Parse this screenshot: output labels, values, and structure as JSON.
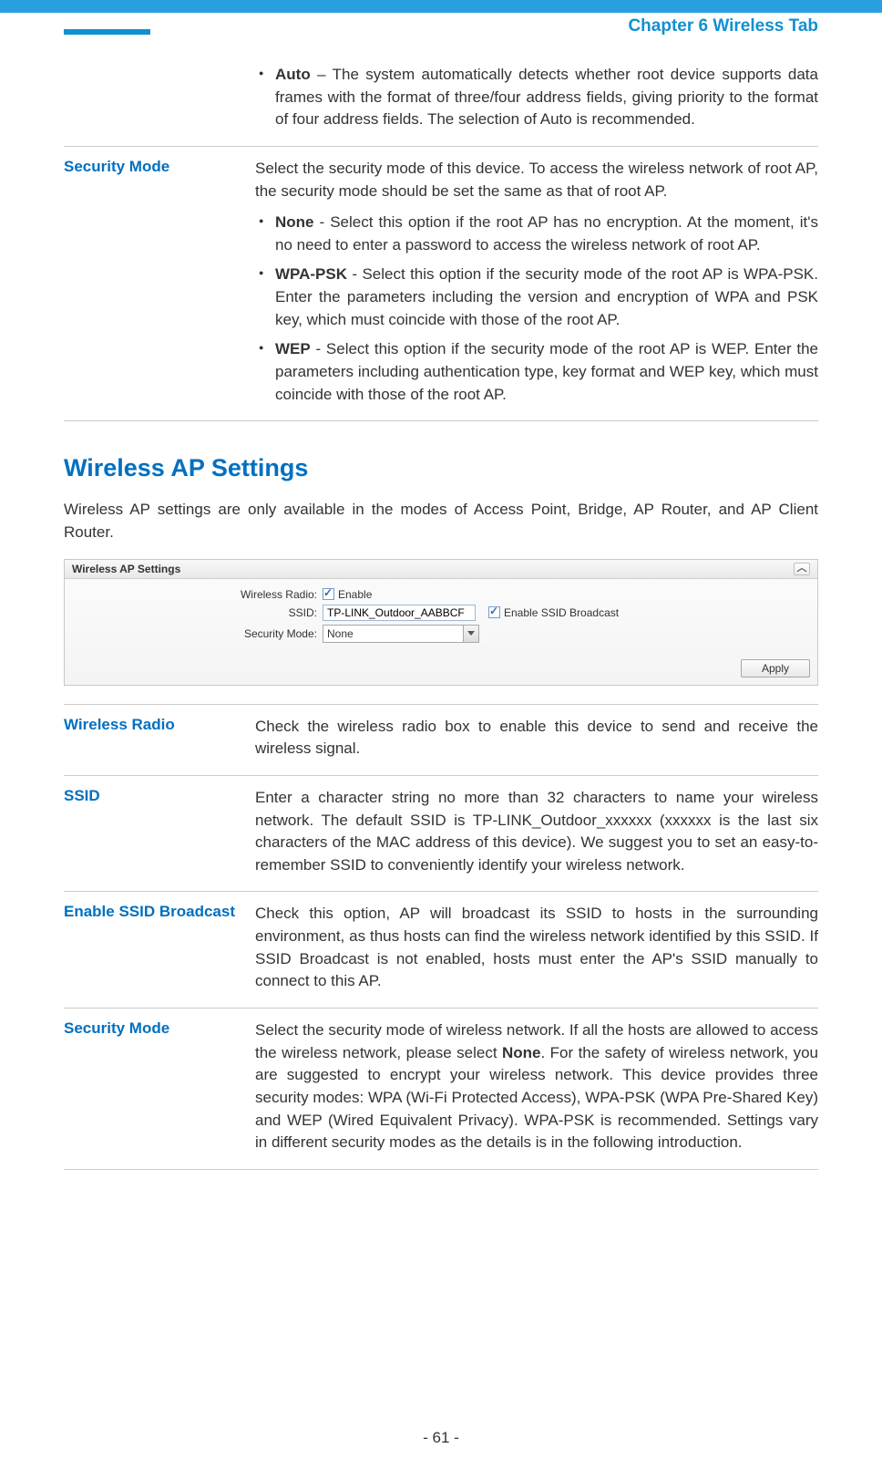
{
  "header": {
    "chapter_title": "Chapter 6 Wireless Tab"
  },
  "top_block": {
    "auto_bullet_bold": "Auto",
    "auto_bullet_text": " – The system automatically detects whether root device supports data frames with the format of three/four address fields, giving priority to the format of four address fields. The selection of Auto is recommended."
  },
  "security_mode_top": {
    "term": "Security Mode",
    "intro": "Select the security mode of this device. To access the wireless network of root AP, the security mode should be set the same as that of root AP.",
    "none_bold": "None",
    "none_text": " - Select this option if the root AP has no encryption. At the moment, it's no need to enter a password to access the wireless network of root AP.",
    "wpa_bold": "WPA-PSK",
    "wpa_text": " - Select this option if the security mode of the root AP is WPA-PSK. Enter the parameters including the version and encryption of WPA and PSK key, which must coincide with those of the root AP.",
    "wep_bold": "WEP",
    "wep_text": " - Select this option if the security mode of the root AP is WEP. Enter the parameters including authentication type, key format and WEP key, which must coincide with those of the root AP."
  },
  "section_title": "Wireless AP Settings",
  "section_intro": "Wireless AP settings are only available in the modes of Access Point, Bridge, AP Router, and AP Client Router.",
  "panel": {
    "title": "Wireless AP Settings",
    "collapse_glyph": "︿",
    "wireless_radio_label": "Wireless Radio:",
    "enable_label": "Enable",
    "ssid_label": "SSID:",
    "ssid_value": "TP-LINK_Outdoor_AABBCF",
    "enable_ssid_broadcast_label": "Enable SSID Broadcast",
    "security_mode_label": "Security Mode:",
    "security_mode_value": "None",
    "apply_label": "Apply"
  },
  "rows": {
    "wireless_radio": {
      "term": "Wireless Radio",
      "desc": "Check the wireless radio box to enable this device to send and receive the wireless signal."
    },
    "ssid": {
      "term": "SSID",
      "desc": "Enter a character string no more than 32 characters to name your wireless network. The default SSID is TP-LINK_Outdoor_xxxxxx (xxxxxx is the last six characters of the MAC address of this device). We suggest you to set an easy-to-remember SSID to conveniently identify your wireless network."
    },
    "enable_ssid_broadcast": {
      "term": "Enable SSID Broadcast",
      "desc": "Check this option, AP will broadcast its SSID to hosts in the surrounding environment, as thus hosts can find the wireless network identified by this SSID. If SSID Broadcast is not enabled, hosts must enter the AP's SSID manually to connect to this AP."
    },
    "security_mode": {
      "term": "Security Mode",
      "desc_pre": "Select the security mode of wireless network. If all the hosts are allowed to access the wireless network, please select ",
      "desc_bold": "None",
      "desc_post": ". For the safety of wireless network, you are suggested to encrypt your wireless network. This device provides three security modes: WPA (Wi-Fi Protected Access), WPA-PSK (WPA Pre-Shared Key) and WEP (Wired Equivalent Privacy). WPA-PSK is recommended. Settings vary in different security modes as the details is in the following introduction."
    }
  },
  "page_number": "- 61 -"
}
